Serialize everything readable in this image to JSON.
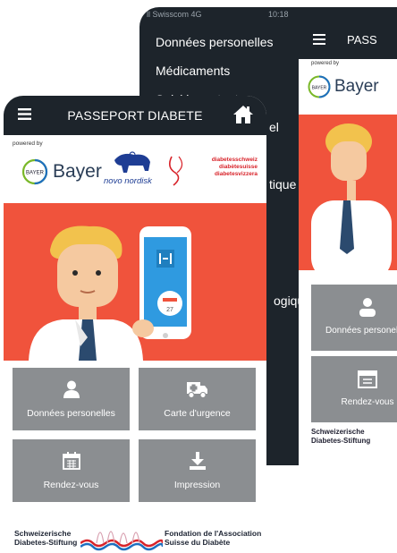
{
  "back_phone": {
    "status": {
      "carrier": "ll Swisscom  4G",
      "time": "10:18"
    },
    "menu_items": [
      "Données personelles",
      "Médicaments",
      "Suivi important",
      "",
      "",
      "",
      "",
      ""
    ],
    "menu_fragments": [
      "el",
      "tique",
      "ogique"
    ],
    "app_title": "PASSEPORT DIABETE",
    "app_title_visible": "PASS",
    "powered": "powered by",
    "bayer": "Bayer",
    "tiles": [
      "Données personelles",
      "Rendez-vous"
    ],
    "footer_left": [
      "Schweizerische",
      "Diabetes-Stiftung"
    ]
  },
  "front_phone": {
    "title": "PASSEPORT DIABETE",
    "powered": "powered by",
    "logos": {
      "bayer": "Bayer",
      "novo": "novo nordisk",
      "diabetes": [
        "diabetesschweiz",
        "diabètesuisse",
        "diabetesvizzera"
      ]
    },
    "tiles": [
      {
        "label": "Données personelles",
        "icon": "person-icon"
      },
      {
        "label": "Carte d'urgence",
        "icon": "ambulance-icon"
      },
      {
        "label": "Rendez-vous",
        "icon": "calendar-icon"
      },
      {
        "label": "Impression",
        "icon": "download-icon"
      }
    ],
    "footer": {
      "left": [
        "Schweizerische",
        "Diabetes-Stiftung"
      ],
      "right": [
        "Fondation de l'Association",
        "Suisse du Diabète"
      ]
    },
    "calendar_badge": "27"
  },
  "colors": {
    "dark": "#1d242b",
    "accent_red": "#f0533c",
    "tile_gray": "#8b8e91",
    "phone_blue": "#2f9ae0"
  }
}
